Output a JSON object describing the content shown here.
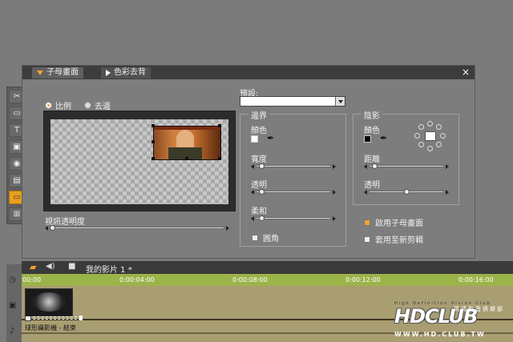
{
  "tabs": [
    {
      "label": "子母畫面",
      "active": true
    },
    {
      "label": "色彩去背",
      "active": false
    }
  ],
  "close_glyph": "×",
  "tools": [
    "scissors-icon",
    "title-icon",
    "text-icon",
    "photo-icon",
    "audio-icon",
    "transition-icon",
    "pip-icon",
    "plugin-icon"
  ],
  "tool_glyphs": [
    "✂",
    "▭",
    "T",
    "▣",
    "◉",
    "▤",
    "▭",
    "⊞"
  ],
  "active_tool_index": 6,
  "mode": {
    "options": [
      "比例",
      "去邊"
    ],
    "selected_index": 0
  },
  "video_opacity": {
    "label": "視訊透明度",
    "value": 0.0
  },
  "preset": {
    "label": "預設:",
    "value": ""
  },
  "border_group": {
    "title": "邊界",
    "color_label": "顏色",
    "color": "#ffffff",
    "width_label": "寬度",
    "width_value": 0.05,
    "opacity_label": "透明",
    "opacity_value": 0.05,
    "soften_label": "柔和",
    "soften_value": 0.05,
    "rounded_label": "圓角",
    "rounded_checked": false
  },
  "shadow_group": {
    "title": "陰影",
    "color_label": "顏色",
    "color": "#000000",
    "distance_label": "距離",
    "distance_value": 0.05,
    "opacity_label": "透明",
    "opacity_value": 0.5
  },
  "enable_pip": {
    "label": "啟用子母畫面",
    "checked": true
  },
  "apply_new_clip": {
    "label": "套用至新剪輯",
    "checked": false
  },
  "timeline": {
    "movie_title": "我的影片 1 *",
    "ticks": [
      "00:00",
      "0:00:04:00",
      "0:00:08:00",
      "0:00:12:00",
      "0:00:16:00"
    ],
    "clip_label": "球形攝影機 - 結束"
  },
  "watermark": {
    "tagline": "High Definition Vision Club",
    "logo": "HDCLUB",
    "chinese": "高清影音俱樂部",
    "url": "WWW.HD.CLUB.TW"
  },
  "colors": {
    "accent": "#f0a030",
    "panel_bg": "#7d7d7d",
    "ruler": "#9ab44a"
  }
}
